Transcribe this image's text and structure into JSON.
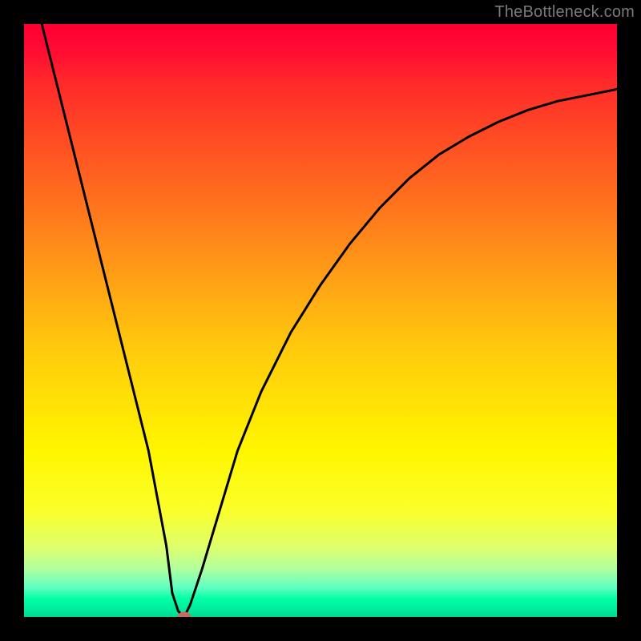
{
  "watermark": "TheBottleneck.com",
  "chart_data": {
    "type": "line",
    "title": "",
    "xlabel": "",
    "ylabel": "",
    "xlim": [
      0,
      100
    ],
    "ylim": [
      0,
      100
    ],
    "series": [
      {
        "name": "bottleneck-curve",
        "x": [
          3,
          6,
          9,
          12,
          15,
          18,
          21,
          24,
          25,
          26,
          27,
          28,
          30,
          33,
          36,
          40,
          45,
          50,
          55,
          60,
          65,
          70,
          75,
          80,
          85,
          90,
          95,
          100
        ],
        "y": [
          100,
          88,
          76,
          64,
          52,
          40,
          28,
          12,
          4,
          1,
          0,
          2,
          8,
          18,
          28,
          38,
          48,
          56,
          63,
          69,
          74,
          78,
          81,
          83.5,
          85.5,
          87,
          88,
          89
        ]
      }
    ],
    "marker": {
      "x": 27,
      "y": 0,
      "color": "#c86a5c",
      "radius_px": 7
    },
    "gradient_stops": [
      {
        "pos": 0.0,
        "color": "#ff0033"
      },
      {
        "pos": 0.22,
        "color": "#ff5522"
      },
      {
        "pos": 0.54,
        "color": "#ffc80d"
      },
      {
        "pos": 0.82,
        "color": "#fbff2a"
      },
      {
        "pos": 0.95,
        "color": "#60ffc0"
      },
      {
        "pos": 1.0,
        "color": "#00d890"
      }
    ]
  }
}
